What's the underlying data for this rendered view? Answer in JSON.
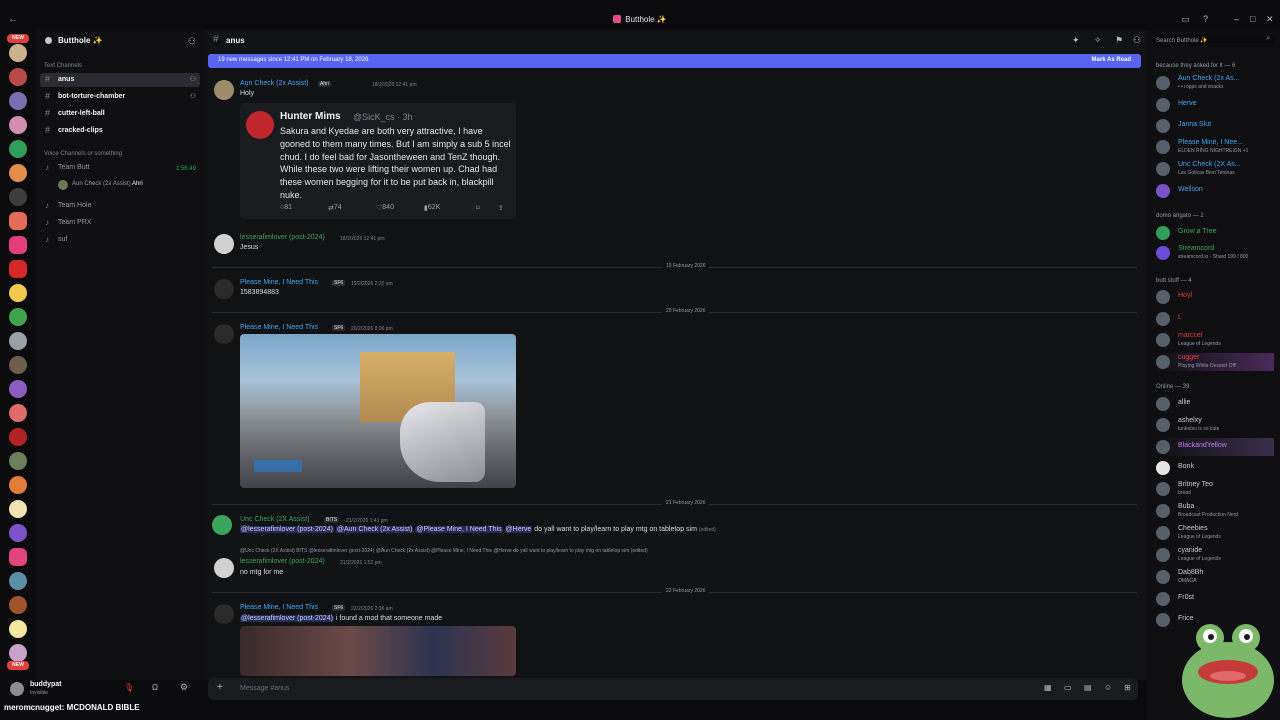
{
  "window": {
    "title": "Butthole ✨"
  },
  "rail": {
    "new_badge_top": "NEW",
    "new_badge_bottom": "NEW"
  },
  "server": {
    "name": "Butthole ✨"
  },
  "sidebar": {
    "text_category": "Text Channels",
    "channels": [
      {
        "name": "anus"
      },
      {
        "name": "bot-torture-chamber"
      },
      {
        "name": "cutter-left-ball"
      },
      {
        "name": "cracked-clips"
      }
    ],
    "voice_category": "Voice Channels or something",
    "voice": [
      {
        "name": "Team Butt",
        "timer": "1:56:49"
      },
      {
        "name": "Team Hole"
      },
      {
        "name": "Team PRX"
      },
      {
        "name": "suf"
      }
    ],
    "voice_user": {
      "name": "Aun Check (2x Assist)",
      "tag": "Ahri"
    }
  },
  "user": {
    "name": "buddypat",
    "status": "Invisible"
  },
  "channel": {
    "name": "anus",
    "new_messages": "19 new messages since 12:41 PM on February 18, 2026",
    "mark_as_read": "Mark As Read",
    "composer_placeholder": "Message #anus"
  },
  "messages": [
    {
      "author": "Aun Check (2x Assist)",
      "tag": "Ahri",
      "time": "18/2/2026 12:41 pm",
      "text": "Holy",
      "color": "#3fa9f5"
    },
    {
      "author": "lesserafimlover (post-2024)",
      "time": "18/2/2026 12:41 pm",
      "text": "Jesus",
      "color": "#3ba55d"
    },
    {
      "author": "Please Mine, I Need This",
      "tag": "SF6",
      "time": "19/2/2026 2:20 am",
      "text": "1583894883",
      "color": "#3fa9f5"
    },
    {
      "author": "Please Mine, I Need This",
      "tag": "SF6",
      "time": "20/2/2026 8:06 pm",
      "text": "",
      "color": "#3fa9f5"
    },
    {
      "author": "Unc Check (2X Assist)",
      "tag": "BITS",
      "time": "21/2/2026 1:41 pm",
      "mentions": [
        "@lesserafimlover (post-2024)",
        "@Aun Check (2x Assist)",
        "@Please Mine, I Need This",
        "@Herve"
      ],
      "text": "do yall want to play/learn to play mtg on tabletop sim",
      "edited": "(edited)",
      "color": "#3ba55d"
    },
    {
      "author": "lesserafimlover (post-2024)",
      "time": "21/2/2026 1:52 pm",
      "reply": "@Unc Check (2X Assist)  BITS  @lesserafimlover (post-2024) @Aun Check (2x Assist) @Please Mine, I Need This @Herve do yall want to play/learn to play mtg on tabletop sim (edited)",
      "text": "no mtg for me",
      "color": "#3ba55d"
    },
    {
      "author": "Please Mine, I Need This",
      "tag": "SF6",
      "time": "22/2/2026 2:36 am",
      "mention": "@lesserafimlover (post-2024)",
      "text": "i found a mod that someone made",
      "color": "#3fa9f5"
    }
  ],
  "dividers": [
    "19 February 2026",
    "20 February 2026",
    "21 February 2026",
    "22 February 2026"
  ],
  "embed": {
    "name": "Hunter Mims",
    "handle": "@SicK_cs · 3h",
    "body": "Sakura and Kyedae are both very attractive, I have gooned to them many times. But I am simply a sub 5 incel chud. I do feel bad for Jasontheween and TenZ though. While these two were lifting their women up. Chad had these women begging for it to be put back in, blackpill nuke.",
    "replies": "81",
    "retweets": "74",
    "likes": "840",
    "views": "62K"
  },
  "members": {
    "search_placeholder": "Search Butthole ✨",
    "groups": [
      {
        "title": "because they asked for it — 6",
        "items": [
          {
            "name": "Aun Check (2x As...",
            "sub": "• • ropps and snacks",
            "color": "#3fa9f5"
          },
          {
            "name": "Herve",
            "sub": "",
            "color": "#3fa9f5"
          },
          {
            "name": "Janna Slut",
            "sub": "",
            "color": "#3fa9f5"
          },
          {
            "name": "Please Mine, I Nee...",
            "sub": "ELDEN RING NIGHTREIGN +1",
            "color": "#3fa9f5"
          },
          {
            "name": "Unc Check (2X As...",
            "sub": "Las Goticas Bien Tetonas",
            "color": "#3fa9f5"
          },
          {
            "name": "Wellson",
            "sub": "",
            "color": "#3fa9f5"
          }
        ]
      },
      {
        "title": "domo arigato — 2",
        "items": [
          {
            "name": "Grow a Tree",
            "sub": "",
            "color": "#3ba55d"
          },
          {
            "name": "Streamcord",
            "sub": "streamcord.io - Shard 199 / 800",
            "color": "#3ba55d"
          }
        ]
      },
      {
        "title": "butt stuff — 4",
        "items": [
          {
            "name": "Hoyl",
            "sub": "",
            "color": "#e23f3f"
          },
          {
            "name": "t.",
            "sub": "",
            "color": "#e23f3f"
          },
          {
            "name": "marccel",
            "sub": "League of Legends",
            "color": "#e23f3f"
          },
          {
            "name": "cugger",
            "sub": "Playing White Dessert Off!",
            "color": "#e23f3f"
          }
        ]
      },
      {
        "title": "Online — 39",
        "items": [
          {
            "name": "allie",
            "sub": "",
            "color": "#c9cbcf"
          },
          {
            "name": "ashelxy",
            "sub": "tunketsu is so cute",
            "color": "#c9cbcf"
          },
          {
            "name": "BlackandYellow",
            "sub": "",
            "color": "#c77dff"
          },
          {
            "name": "Bonk",
            "sub": "",
            "color": "#c9cbcf"
          },
          {
            "name": "Britney Teo",
            "sub": "bread",
            "color": "#c9cbcf"
          },
          {
            "name": "Buba",
            "sub": "Broadcast Production Nerd",
            "color": "#c9cbcf"
          },
          {
            "name": "Cheebies",
            "sub": "League of Legends",
            "color": "#c9cbcf"
          },
          {
            "name": "cyanide",
            "sub": "League of Legends",
            "color": "#c9cbcf"
          },
          {
            "name": "Dab8Bh",
            "sub": "OMAGA",
            "color": "#c9cbcf"
          },
          {
            "name": "Fr0st",
            "sub": "",
            "color": "#c9cbcf"
          },
          {
            "name": "Frice",
            "sub": "",
            "color": "#c9cbcf"
          }
        ]
      }
    ]
  },
  "caption": "meromcnugget: MCDONALD BIBLE"
}
